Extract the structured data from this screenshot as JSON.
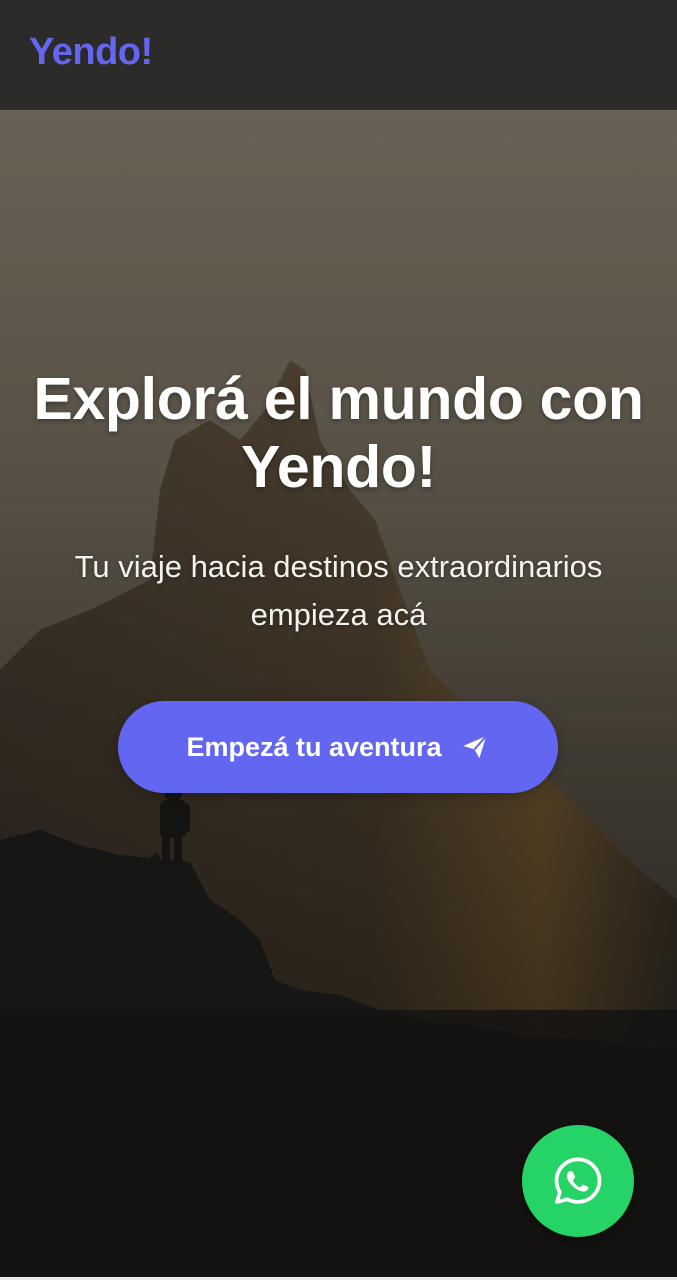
{
  "header": {
    "brand": "Yendo!"
  },
  "hero": {
    "title": "Explorá el mundo con Yendo!",
    "subtitle": "Tu viaje hacia destinos extraordinarios empieza acá",
    "cta_label": "Empezá tu aventura",
    "cta_icon": "paper-plane-icon",
    "background_image": "mountain-silhouette-with-hiker"
  },
  "floating_action": {
    "icon": "whatsapp-icon"
  },
  "colors": {
    "brand": "#6366f1",
    "cta": "#6366f1",
    "topbar": "#2d2b2a",
    "whatsapp": "#25d366"
  }
}
